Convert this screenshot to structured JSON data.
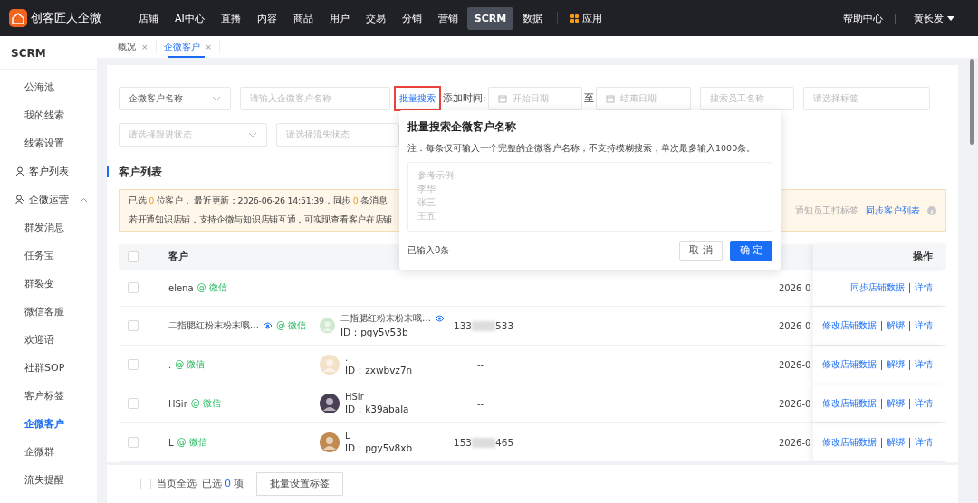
{
  "topbar": {
    "brand": "创客匠人企微",
    "nav": [
      {
        "label": "店铺",
        "selected": false
      },
      {
        "label": "AI中心",
        "selected": false
      },
      {
        "label": "直播",
        "selected": false
      },
      {
        "label": "内容",
        "selected": false
      },
      {
        "label": "商品",
        "selected": false
      },
      {
        "label": "用户",
        "selected": false
      },
      {
        "label": "交易",
        "selected": false
      },
      {
        "label": "分销",
        "selected": false
      },
      {
        "label": "营销",
        "selected": false
      },
      {
        "label": "SCRM",
        "selected": true
      },
      {
        "label": "数据",
        "selected": false
      }
    ],
    "apps": "应用",
    "help": "帮助中心",
    "divider": "|",
    "user": "黄长发"
  },
  "sidebar": {
    "title": "SCRM",
    "items": [
      {
        "label": "公海池",
        "kind": "link",
        "selected": false
      },
      {
        "label": "我的线索",
        "kind": "link",
        "selected": false
      },
      {
        "label": "线索设置",
        "kind": "link",
        "selected": false
      },
      {
        "label": "客户列表",
        "kind": "group",
        "expanded": false
      },
      {
        "label": "企微运营",
        "kind": "group",
        "expanded": true,
        "children": [
          {
            "label": "群发消息",
            "selected": false
          },
          {
            "label": "任务宝",
            "selected": false
          },
          {
            "label": "群裂变",
            "selected": false
          },
          {
            "label": "微信客服",
            "selected": false
          },
          {
            "label": "欢迎语",
            "selected": false
          },
          {
            "label": "社群SOP",
            "selected": false
          },
          {
            "label": "客户标签",
            "selected": false
          },
          {
            "label": "企微客户",
            "selected": true
          },
          {
            "label": "企微群",
            "selected": false
          },
          {
            "label": "流失提醒",
            "selected": false
          }
        ]
      }
    ]
  },
  "page_tabs": [
    {
      "label": "概况",
      "close": "×",
      "selected": false
    },
    {
      "label": "企微客户",
      "close": "×",
      "selected": true
    }
  ],
  "filters": {
    "field_select": {
      "value": "企微客户名称"
    },
    "name_input": {
      "placeholder": "请输入企微客户名称"
    },
    "batch_search": {
      "label": "批量搜索"
    },
    "date_label": "添加时间:",
    "start_date": {
      "placeholder": "开始日期"
    },
    "separator": "至",
    "end_date": {
      "placeholder": "结束日期"
    },
    "employee": {
      "placeholder": "搜索员工名称"
    },
    "tag": {
      "placeholder": "请选择标签"
    },
    "follow_status": {
      "placeholder": "请选择跟进状态"
    },
    "churn_status": {
      "placeholder": "请选择流失状态"
    }
  },
  "section_title": "客户列表",
  "banner": {
    "line1": [
      {
        "text": "已选 ",
        "highlight": false
      },
      {
        "text": "0",
        "highlight": true
      },
      {
        "text": " 位客户， 最近更新：2026-06-26 14:51:39，同步 ",
        "highlight": false
      },
      {
        "text": "0",
        "highlight": true
      },
      {
        "text": " 条消息",
        "highlight": false
      }
    ],
    "line2": "若开通知识店铺，支持企微与知识店铺互通，可实现查看客户在店铺",
    "notify": "通知员工打标签",
    "sync": "同步客户列表"
  },
  "table": {
    "header_checked": false,
    "columns": {
      "customer": "客户",
      "actions": "操作"
    },
    "rows": [
      {
        "checked": false,
        "customer": "elena",
        "eye": false,
        "tag": "@ 微信",
        "member": null,
        "empty": "--",
        "phone": {
          "kind": "empty",
          "text": "--"
        },
        "date": "2026-0",
        "actions": [
          "同步店铺数据",
          "详情"
        ]
      },
      {
        "checked": false,
        "customer": "二指腮红粉末粉末哦…",
        "eye": true,
        "tag": "@ 微信",
        "member": {
          "name": "二指腮红粉末粉末哦…",
          "eye": true,
          "id": "ID：pgy5v53b"
        },
        "phone": {
          "kind": "masked",
          "prefix": "133",
          "suffix": "533"
        },
        "date": "2026-0",
        "actions": [
          "修改店铺数据",
          "解绑",
          "详情"
        ]
      },
      {
        "checked": false,
        "customer": ".",
        "eye": false,
        "tag": "@ 微信",
        "member": {
          "name": ".",
          "eye": false,
          "id": "ID：zxwbvz7n"
        },
        "phone": {
          "kind": "empty",
          "text": "--"
        },
        "date": "2026-0",
        "actions": [
          "修改店铺数据",
          "解绑",
          "详情"
        ]
      },
      {
        "checked": false,
        "customer": "HSir",
        "eye": false,
        "tag": "@ 微信",
        "member": {
          "name": "HSir",
          "eye": false,
          "id": "ID：k39abala"
        },
        "phone": {
          "kind": "empty",
          "text": "--"
        },
        "date": "2026-0",
        "actions": [
          "修改店铺数据",
          "解绑",
          "详情"
        ]
      },
      {
        "checked": false,
        "customer": "L",
        "eye": false,
        "tag": "@ 微信",
        "member": {
          "name": "L",
          "eye": false,
          "id": "ID：pgy5v8xb"
        },
        "phone": {
          "kind": "masked",
          "prefix": "153",
          "suffix": "465"
        },
        "date": "2026-0",
        "actions": [
          "修改店铺数据",
          "解绑",
          "详情"
        ]
      }
    ]
  },
  "footer": {
    "select_all": {
      "label": "当页全选",
      "checked": false
    },
    "selected_label": "已选",
    "selected_count": "0",
    "unit": "项",
    "button": "批量设置标签"
  },
  "popover": {
    "title": "批量搜索企微客户名称",
    "note": "注：每条仅可输入一个完整的企微客户名称，不支持模糊搜索，单次最多输入1000条。",
    "placeholder_lines": [
      "参考示例:",
      "李华",
      "张三",
      "王五"
    ],
    "count": "已输入0条",
    "cancel": "取 消",
    "confirm": "确 定"
  }
}
